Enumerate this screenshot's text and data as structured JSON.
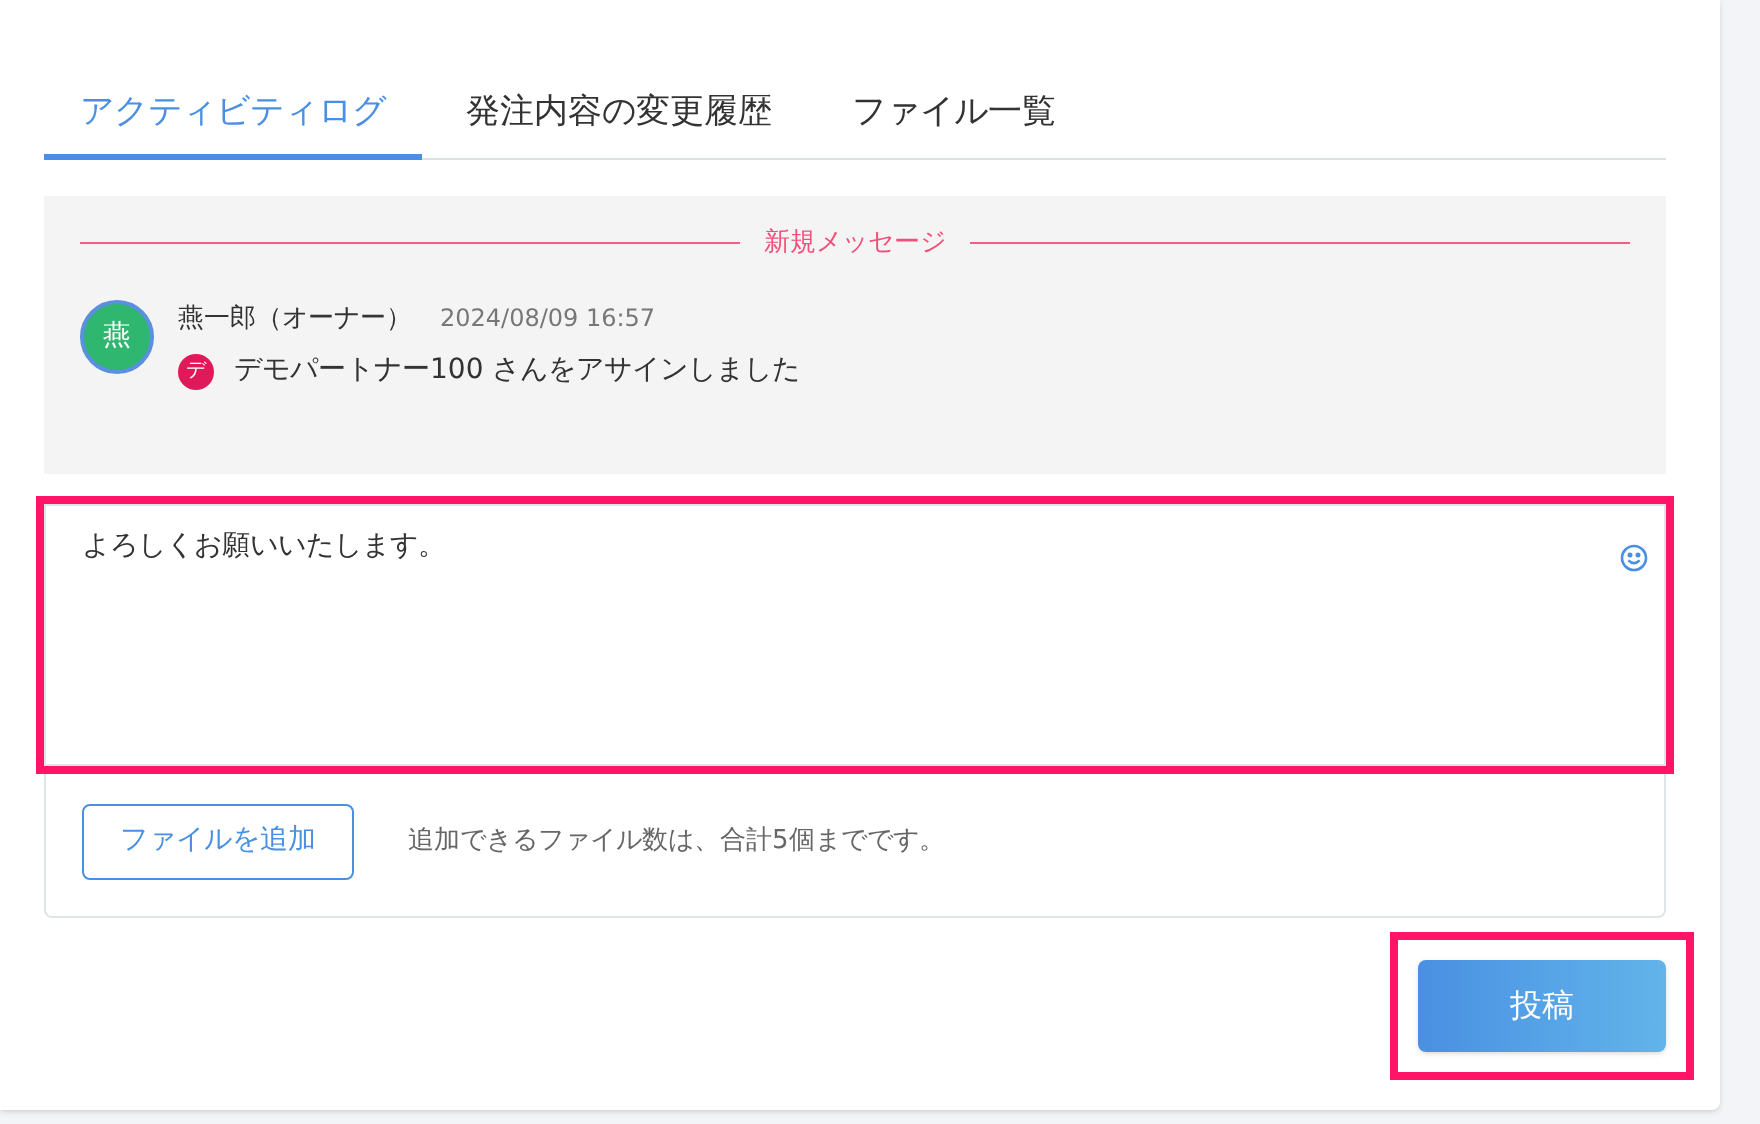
{
  "tabs": [
    {
      "label": "アクティビティログ",
      "selected": true
    },
    {
      "label": "発注内容の変更履歴",
      "selected": false
    },
    {
      "label": "ファイル一覧",
      "selected": false
    }
  ],
  "activity": {
    "divider_label": "新規メッセージ",
    "entries": [
      {
        "avatar": "燕",
        "author": "燕一郎（オーナー）",
        "time": "2024/08/09 16:57",
        "badge": "デ",
        "color": "#e0195a",
        "message": "デモパートナー100 さんをアサインしました"
      }
    ]
  },
  "composer": {
    "value": "よろしくお願いいたします。",
    "highlighted": true,
    "add_file_button": "ファイルを追加",
    "file_note": "追加できるファイル数は、合計5個までです。"
  },
  "post_button": {
    "label": "投稿",
    "highlighted": true
  }
}
